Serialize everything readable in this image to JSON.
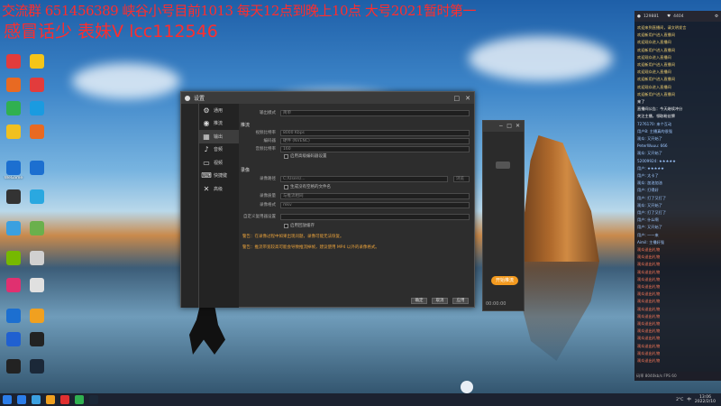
{
  "overlay": {
    "line1": "交流群 651456389 峡谷小号目前1013 每天12点到晚上10点 大号2021暂时第一",
    "line2": "感冒话少  表妹V lcc112546"
  },
  "desktop_icons": [
    {
      "name": "app-icon",
      "label": "",
      "color": "#e23c3c"
    },
    {
      "name": "app-icon",
      "label": "",
      "color": "#f5c518"
    },
    {
      "name": "app-icon",
      "label": "",
      "color": "#e86a22"
    },
    {
      "name": "app-icon",
      "label": "",
      "color": "#e23c3c"
    },
    {
      "name": "app-icon",
      "label": "",
      "color": "#30b050"
    },
    {
      "name": "app-icon",
      "label": "",
      "color": "#1a9be0"
    },
    {
      "name": "app-icon",
      "label": "",
      "color": "#f0c020"
    },
    {
      "name": "app-icon",
      "label": "",
      "color": "#e86a22"
    },
    {
      "name": "app-icon",
      "label": "WeGame",
      "color": "#1c6fd0"
    },
    {
      "name": "app-icon",
      "label": "",
      "color": "#1c6fd0"
    },
    {
      "name": "app-icon",
      "label": "",
      "color": "#333333"
    },
    {
      "name": "app-icon",
      "label": "",
      "color": "#2aa8e0"
    },
    {
      "name": "app-icon",
      "label": "",
      "color": "#3ba0e0"
    },
    {
      "name": "app-icon",
      "label": "",
      "color": "#6ab04c"
    },
    {
      "name": "app-icon",
      "label": "",
      "color": "#76b900"
    },
    {
      "name": "app-icon",
      "label": "",
      "color": "#d0d0d0"
    },
    {
      "name": "app-icon",
      "label": "",
      "color": "#e03070"
    },
    {
      "name": "app-icon",
      "label": "",
      "color": "#e0e0e0"
    },
    {
      "name": "app-icon",
      "label": "",
      "color": "#1c6fd0"
    },
    {
      "name": "app-icon",
      "label": "",
      "color": "#f0a020"
    },
    {
      "name": "app-icon",
      "label": "",
      "color": "#2060d0"
    },
    {
      "name": "app-icon",
      "label": "",
      "color": "#222222"
    },
    {
      "name": "app-icon",
      "label": "",
      "color": "#222222"
    },
    {
      "name": "app-icon",
      "label": "",
      "color": "#1b2838"
    }
  ],
  "settings": {
    "title": "设置",
    "left_label": "",
    "nav": [
      {
        "label": "通用",
        "icon": "⚙"
      },
      {
        "label": "推流",
        "icon": "◉"
      },
      {
        "label": "输出",
        "icon": "▦"
      },
      {
        "label": "音频",
        "icon": "♪"
      },
      {
        "label": "视频",
        "icon": "▭"
      },
      {
        "label": "快捷键",
        "icon": "⌨"
      },
      {
        "label": "高级",
        "icon": "✕"
      }
    ],
    "top_row": {
      "label": "输出模式",
      "value": "简单"
    },
    "stream_section": "推流",
    "stream_rows": [
      {
        "label": "视频比特率",
        "value": "8000 Kbps"
      },
      {
        "label": "编码器",
        "value": "硬件 (NVENC)"
      },
      {
        "label": "音频比特率",
        "value": "160"
      }
    ],
    "stream_check": "启用高级编码器设置",
    "record_section": "录像",
    "record_rows": [
      {
        "label": "录像路径",
        "value": "C:/Users/..."
      },
      {
        "label": "录像质量",
        "value": "与推流相同"
      },
      {
        "label": "录像格式",
        "value": "mkv"
      }
    ],
    "record_check1": "生成没有空格的文件名",
    "record_row_extra": {
      "label": "自定义复用器设置",
      "value": ""
    },
    "record_check2": "启用回放缓存",
    "browse_btn": "浏览",
    "warn1": "警告：在录像过程中如果出现问题，录像可能无法恢复。",
    "warn2": "警告：推流带宽较高可能会导致推流掉帧，建议使用 MP4 以外的录像格式。",
    "buttons": {
      "ok": "确定",
      "cancel": "取消",
      "apply": "应用"
    }
  },
  "obs_back": {
    "chip": "开始推流",
    "footer": "00:00:00"
  },
  "chat": {
    "header": [
      "129881",
      "4404"
    ],
    "messages": [
      {
        "text": "欢迎来到直播间，请文明发言",
        "color": "#f0d070"
      },
      {
        "text": "欢迎新用户进入直播间",
        "color": "#f0d070"
      },
      {
        "text": "欢迎观众进入直播间",
        "color": "#f0d070"
      },
      {
        "text": "欢迎新用户进入直播间",
        "color": "#f0d070"
      },
      {
        "text": "欢迎观众进入直播间",
        "color": "#f0d070"
      },
      {
        "text": "欢迎新用户进入直播间",
        "color": "#f0d070"
      },
      {
        "text": "欢迎观众进入直播间",
        "color": "#f0d070"
      },
      {
        "text": "欢迎新用户进入直播间",
        "color": "#f0d070"
      },
      {
        "text": "欢迎观众进入直播间",
        "color": "#f0d070"
      },
      {
        "text": "欢迎新用户进入直播间",
        "color": "#f0d070"
      },
      {
        "text": "来了",
        "color": "#ffffff"
      },
      {
        "text": "直播间公告：今天继续冲分",
        "color": "#ffffff"
      },
      {
        "text": "关注主播，领取粉丝牌",
        "color": "#ffffff"
      },
      {
        "text": "7276170: 来个互动",
        "color": "#9fc8ff"
      },
      {
        "text": "用户8: 主播真的很强",
        "color": "#9fc8ff"
      },
      {
        "text": "观众: 又开始了",
        "color": "#9fc8ff"
      },
      {
        "text": "PeterWuuu: 666",
        "color": "#9fc8ff"
      },
      {
        "text": "观众: 又开始了",
        "color": "#9fc8ff"
      },
      {
        "text": "52009924: ★★★★★",
        "color": "#9fc8ff"
      },
      {
        "text": "用户: ★★★★★",
        "color": "#9fc8ff"
      },
      {
        "text": "用户: 太卡了",
        "color": "#9fc8ff"
      },
      {
        "text": "观众: 加油加油",
        "color": "#9fc8ff"
      },
      {
        "text": "用户: 打得好",
        "color": "#9fc8ff"
      },
      {
        "text": "用户: 打了又打了",
        "color": "#9fc8ff"
      },
      {
        "text": "观众: 又开始了",
        "color": "#9fc8ff"
      },
      {
        "text": "用户: 打了又打了",
        "color": "#9fc8ff"
      },
      {
        "text": "用户: 什么啊",
        "color": "#9fc8ff"
      },
      {
        "text": "用户: 又开始了",
        "color": "#9fc8ff"
      },
      {
        "text": "用户: 一一来",
        "color": "#9fc8ff"
      },
      {
        "text": "Aimil: 主播好强",
        "color": "#9fc8ff"
      },
      {
        "text": "观众送出礼物",
        "color": "#ff7a5a"
      },
      {
        "text": "观众送出礼物",
        "color": "#ff7a5a"
      },
      {
        "text": "观众送出礼物",
        "color": "#ff7a5a"
      },
      {
        "text": "观众送出礼物",
        "color": "#ff7a5a"
      },
      {
        "text": "观众送出礼物",
        "color": "#ff7a5a"
      },
      {
        "text": "观众送出礼物",
        "color": "#ff7a5a"
      },
      {
        "text": "观众送出礼物",
        "color": "#ff7a5a"
      },
      {
        "text": "观众送出礼物",
        "color": "#ff7a5a"
      },
      {
        "text": "观众送出礼物",
        "color": "#ff7a5a"
      },
      {
        "text": "观众送出礼物",
        "color": "#ff7a5a"
      },
      {
        "text": "观众送出礼物",
        "color": "#ff7a5a"
      },
      {
        "text": "观众送出礼物",
        "color": "#ff7a5a"
      },
      {
        "text": "观众送出礼物",
        "color": "#ff7a5a"
      },
      {
        "text": "观众送出礼物",
        "color": "#ff7a5a"
      },
      {
        "text": "观众送出礼物",
        "color": "#ff7a5a"
      },
      {
        "text": "观众送出礼物",
        "color": "#ff7a5a"
      }
    ],
    "footer": "码率 8040kb/s  FPS 60"
  },
  "taskbar": {
    "apps": [
      "#2b7de9",
      "#3ba0e0",
      "#f0a020",
      "#e03030",
      "#30b050",
      "#1b2838"
    ],
    "tray": [
      "2°C",
      "中"
    ],
    "time": "13:06",
    "date": "2022/2/10"
  }
}
